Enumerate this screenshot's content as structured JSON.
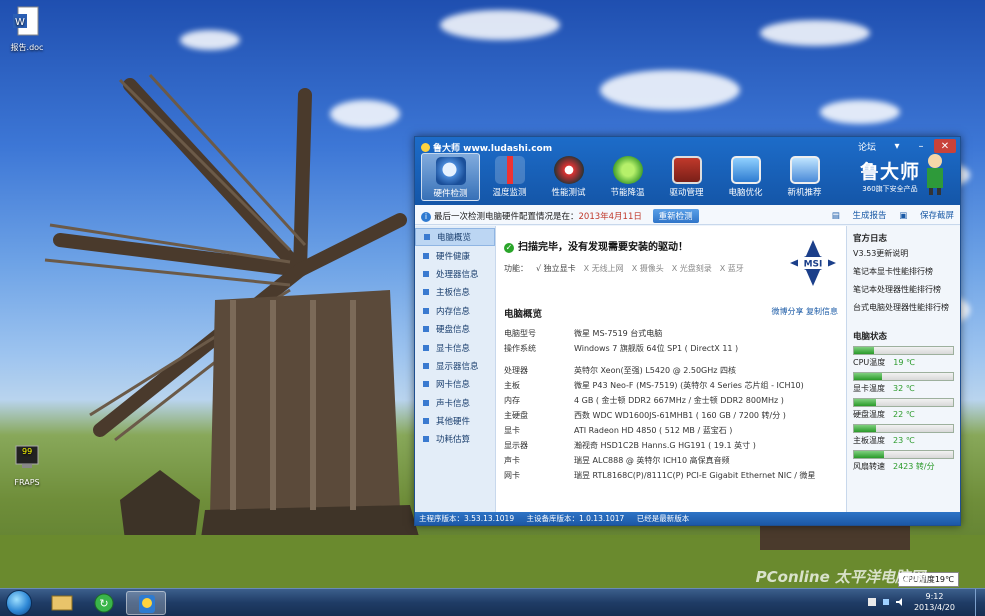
{
  "desktop": {
    "icons": [
      {
        "name": "doc-file-icon",
        "label": "报告.doc"
      },
      {
        "name": "fraps-icon",
        "label": "FRAPS",
        "badge": "99"
      }
    ]
  },
  "app": {
    "title": "鲁大师 www.ludashi.com",
    "forum": "论坛",
    "toolbar": [
      {
        "label": "硬件检测",
        "icon": "magnifier-icon",
        "active": true
      },
      {
        "label": "温度监测",
        "icon": "thermometer-icon"
      },
      {
        "label": "性能测试",
        "icon": "speedometer-icon"
      },
      {
        "label": "节能降温",
        "icon": "leaf-icon"
      },
      {
        "label": "驱动管理",
        "icon": "driver-chip-icon"
      },
      {
        "label": "电脑优化",
        "icon": "monitor-optimize-icon"
      },
      {
        "label": "新机推荐",
        "icon": "new-pc-icon"
      }
    ],
    "brand": {
      "name": "鲁大师",
      "tagline": "360旗下安全产品"
    },
    "infobar": {
      "text": "最后一次检测电脑硬件配置情况是在：",
      "date": "2013年4月11日",
      "recheck": "重新检测",
      "report": "生成报告",
      "save": "保存截屏"
    },
    "sidebar": [
      "电脑概览",
      "硬件健康",
      "处理器信息",
      "主板信息",
      "内存信息",
      "硬盘信息",
      "显卡信息",
      "显示器信息",
      "网卡信息",
      "声卡信息",
      "其他硬件",
      "功耗估算"
    ],
    "main": {
      "scan_status": "扫描完毕，没有发现需要安装的驱动！",
      "features_label": "功能：",
      "features": [
        {
          "mark": "√",
          "text": "独立显卡",
          "ok": true
        },
        {
          "mark": "X",
          "text": "无线上网",
          "ok": false
        },
        {
          "mark": "X",
          "text": "摄像头",
          "ok": false
        },
        {
          "mark": "X",
          "text": "光盘刻录",
          "ok": false
        },
        {
          "mark": "X",
          "text": "蓝牙",
          "ok": false
        }
      ],
      "msi_logo": "MSI",
      "overview_title": "电脑概览",
      "share": "微博分享",
      "copy": "复制信息",
      "specs_a": [
        {
          "k": "电脑型号",
          "v": "微星 MS-7519 台式电脑"
        },
        {
          "k": "操作系统",
          "v": "Windows 7 旗舰版 64位 SP1 ( DirectX 11 )"
        }
      ],
      "specs_b": [
        {
          "k": "处理器",
          "v": "英特尔 Xeon(至强) L5420 @ 2.50GHz 四核"
        },
        {
          "k": "主板",
          "v": "微星 P43 Neo-F (MS-7519) (英特尔 4 Series 芯片组 - ICH10)"
        },
        {
          "k": "内存",
          "v": "4 GB ( 金士顿 DDR2 667MHz / 金士顿 DDR2 800MHz )"
        },
        {
          "k": "主硬盘",
          "v": "西数 WDC WD1600JS-61MHB1 ( 160 GB / 7200 转/分 )"
        },
        {
          "k": "显卡",
          "v": "ATI Radeon HD 4850  ( 512 MB / 蓝宝石 )"
        },
        {
          "k": "显示器",
          "v": "瀚视奇 HSD1C2B Hanns.G HG191 ( 19.1 英寸 )"
        },
        {
          "k": "声卡",
          "v": "瑞昱 ALC888 @ 英特尔 ICH10 高保真音频"
        },
        {
          "k": "网卡",
          "v": "瑞昱 RTL8168C(P)/8111C(P) PCI-E Gigabit Ethernet NIC / 微星"
        }
      ]
    },
    "right": {
      "news_title": "官方日志",
      "news": [
        "V3.53更新说明",
        "笔记本显卡性能排行榜",
        "笔记本处理器性能排行榜",
        "台式电脑处理器性能排行榜"
      ],
      "status_title": "电脑状态",
      "stats": [
        {
          "label": "CPU温度",
          "value": "19 ℃",
          "level": 0.2
        },
        {
          "label": "显卡温度",
          "value": "32 ℃",
          "level": 0.28
        },
        {
          "label": "硬盘温度",
          "value": "22 ℃",
          "level": 0.22
        },
        {
          "label": "主板温度",
          "value": "23 ℃",
          "level": 0.22
        },
        {
          "label": "风扇转速",
          "value": "2423 转/分",
          "level": 0.3
        }
      ]
    },
    "statusbar": {
      "program_version": "主程序版本：3.53.13.1019",
      "hw_version": "主设备库版本：1.0.13.1017",
      "latest": "已经是最新版本"
    }
  },
  "taskbar": {
    "time": "9:12",
    "date": "2013/4/20",
    "cpu_tip": "CPU温度19℃",
    "watermark": "PConline 太平洋电脑网"
  }
}
